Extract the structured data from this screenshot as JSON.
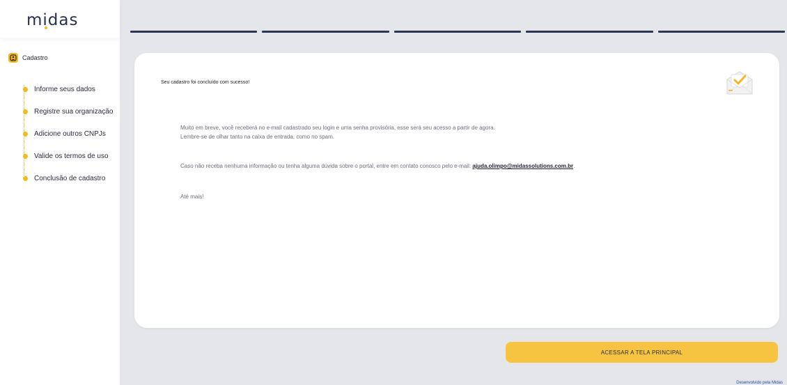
{
  "top_mark": "`",
  "logo": {
    "text": "midas"
  },
  "sidebar": {
    "section_label": "Cadastro",
    "steps": [
      {
        "label": "Informe seus dados"
      },
      {
        "label": "Registre sua organização"
      },
      {
        "label": "Adicione outros CNPJs"
      },
      {
        "label": "Valide os termos de uso"
      },
      {
        "label": "Conclusão de cadastro"
      }
    ]
  },
  "card": {
    "title": "Seu cadastro foi concluído com sucesso!",
    "paragraph1_line1": "Muito em breve, você receberá no e-mail cadastrado seu login e uma senha provisória, esse será seu acesso a partir de agora.",
    "paragraph1_line2": "Lembre-se de olhar tanto na caixa de entrada, como no spam.",
    "paragraph2_prefix": "Caso não receba nenhuma informação ou tenha alguma dúvida sobre o portal, entre em contato conosco pelo e-mail:",
    "paragraph2_email": "ajuda.olimpo@midassolutions.com.br",
    "paragraph2_suffix": ".",
    "closing": "Até mais!"
  },
  "actions": {
    "main_button_label": "ACESSAR A TELA PRINCIPAL"
  },
  "footer": {
    "text": "Desenvolvido pela Midas"
  },
  "colors": {
    "accent": "#f5b81e",
    "button": "#f7c441",
    "tab_bar": "#2b3656",
    "background": "#e4e6ea"
  },
  "icons": {
    "section": "user-badge-icon",
    "success": "envelope-check-icon"
  }
}
